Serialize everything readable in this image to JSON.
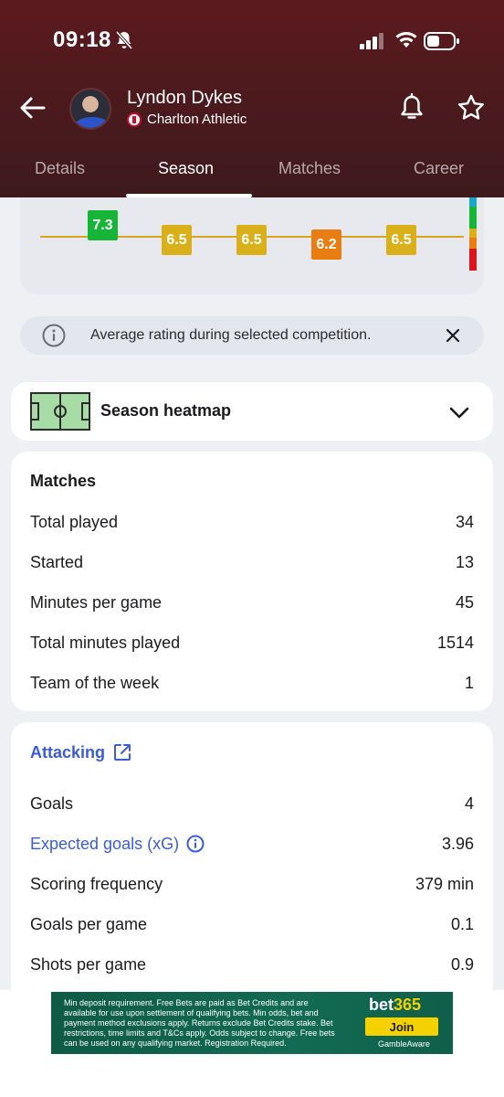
{
  "status": {
    "time": "09:18"
  },
  "player": {
    "name": "Lyndon Dykes",
    "club": "Charlton Athletic"
  },
  "tabs": [
    "Details",
    "Season",
    "Matches",
    "Career"
  ],
  "active_tab": "Season",
  "ratings": [
    "7.3",
    "6.5",
    "6.5",
    "6.2",
    "6.5"
  ],
  "info_banner": {
    "text": "Average rating during selected competition."
  },
  "heatmap": {
    "label": "Season heatmap"
  },
  "matches": {
    "title": "Matches",
    "rows": [
      {
        "label": "Total played",
        "value": "34"
      },
      {
        "label": "Started",
        "value": "13"
      },
      {
        "label": "Minutes per game",
        "value": "45"
      },
      {
        "label": "Total minutes played",
        "value": "1514"
      },
      {
        "label": "Team of the week",
        "value": "1"
      }
    ]
  },
  "attacking": {
    "title": "Attacking",
    "rows": [
      {
        "label": "Goals",
        "value": "4"
      },
      {
        "label": "Expected goals (xG)",
        "value": "3.96"
      },
      {
        "label": "Scoring frequency",
        "value": "379 min"
      },
      {
        "label": "Goals per game",
        "value": "0.1"
      },
      {
        "label": "Shots per game",
        "value": "0.9"
      }
    ]
  },
  "ad": {
    "text": "Min deposit requirement. Free Bets are paid as Bet Credits and are available for use upon settlement of qualifying bets. Min odds, bet and payment method exclusions apply. Returns exclude Bet Credits stake. Bet restrictions, time limits and T&Cs apply. Odds subject to change. Free bets can be used on any qualifying market. Registration Required.",
    "brand_a": "bet",
    "brand_b": "365",
    "cta": "Join",
    "footer": "GambleAware"
  },
  "colors": {
    "header": "#4a1a1d",
    "link": "#3b5bdb",
    "rating_green": "#16b437",
    "rating_yellow": "#d9b01a",
    "rating_orange": "#ea7d11"
  }
}
